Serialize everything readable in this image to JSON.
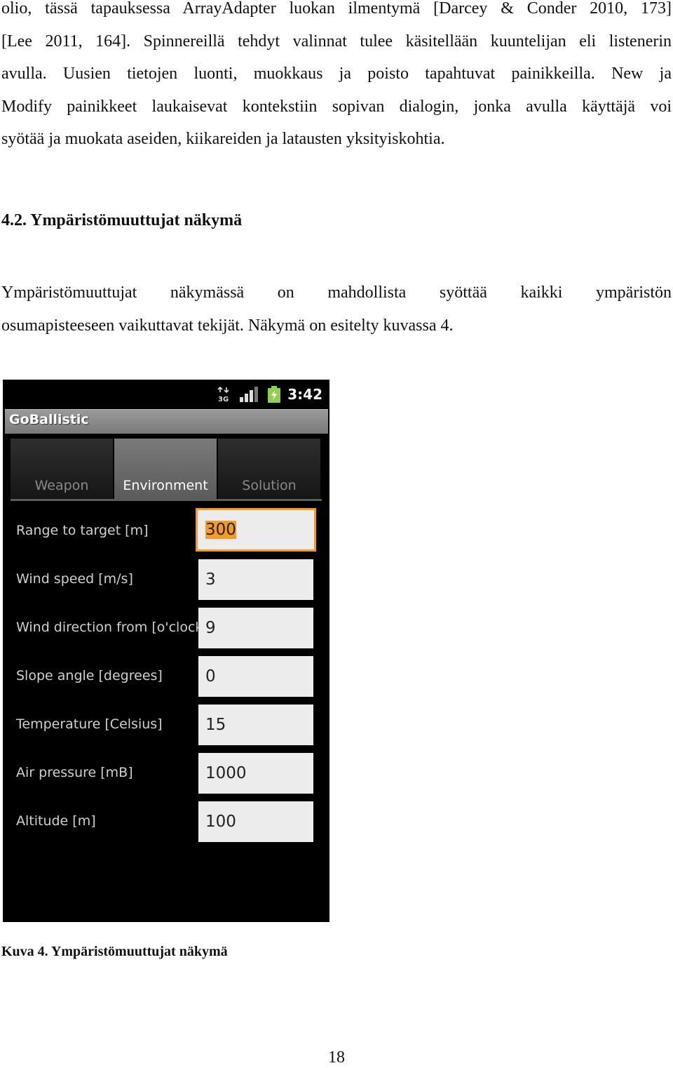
{
  "paragraph1": [
    "olio, tässä tapauksessa ArrayAdapter luokan ilmentymä [Darcey & Conder 2010, 173]",
    "[Lee 2011, 164]. Spinnereillä tehdyt valinnat tulee käsitellään kuuntelijan eli listenerin",
    "avulla. Uusien tietojen luonti, muokkaus ja poisto tapahtuvat painikkeilla. New ja",
    "Modify painikkeet laukaisevat kontekstiin sopivan dialogin, jonka avulla käyttäjä voi",
    "syötää ja muokata aseiden, kiikareiden ja latausten yksityiskohtia."
  ],
  "heading": "4.2. Ympäristömuuttujat näkymä",
  "paragraph2": [
    "Ympäristömuuttujat näkymässä on mahdollista syöttää kaikki ympäristön",
    "osumapisteeseen vaikuttavat tekijät. Näkymä on esitelty kuvassa 4."
  ],
  "phone": {
    "status": {
      "clock": "3:42",
      "icons": [
        "3g-icon",
        "signal-icon",
        "battery-charging-icon"
      ]
    },
    "app_title": "GoBallistic",
    "tabs": [
      {
        "label": "Weapon",
        "active": false
      },
      {
        "label": "Environment",
        "active": true
      },
      {
        "label": "Solution",
        "active": false
      }
    ],
    "fields": [
      {
        "label": "Range to target [m]",
        "value": "300",
        "focused": true
      },
      {
        "label": "Wind speed [m/s]",
        "value": "3"
      },
      {
        "label": "Wind direction from [o'clock]",
        "value": "9"
      },
      {
        "label": "Slope angle [degrees]",
        "value": "0"
      },
      {
        "label": "Temperature [Celsius]",
        "value": "15"
      },
      {
        "label": "Air pressure [mB]",
        "value": "1000"
      },
      {
        "label": "Altitude [m]",
        "value": "100"
      }
    ],
    "colors": {
      "focus_accent": "#f59b22",
      "titlebar": "#8a8a8a",
      "field_bg": "#ececec"
    }
  },
  "caption": "Kuva 4. Ympäristömuuttujat näkymä",
  "page_number": "18"
}
